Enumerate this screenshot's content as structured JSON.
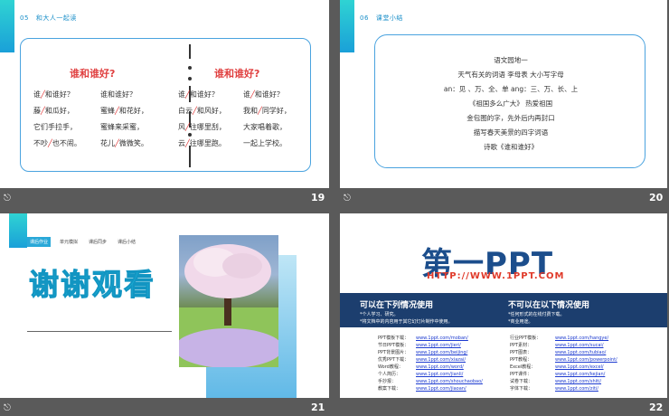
{
  "slides": [
    {
      "number": "19",
      "section_num": "05",
      "section_title": "和大人一起读",
      "footer_icon": "⎋",
      "left_poem": {
        "title": "谁和谁好?",
        "lines": [
          [
            "谁",
            "和谁好？",
            "谁和谁好？"
          ],
          [
            "藤",
            "和瓜好，",
            "蜜蜂",
            "和花好，"
          ],
          [
            "它们手拉手，",
            "蜜蜂来采蜜，"
          ],
          [
            "不吵",
            "也不闹。",
            "花儿",
            "微微笑。"
          ]
        ]
      },
      "left_col_a": [
        "谁╱和谁好？",
        "藤╱和瓜好，",
        "它们手拉手，",
        "不吵╱也不闹。"
      ],
      "left_col_b": [
        "谁和谁好？",
        "蜜蜂╱和花好，",
        "蜜蜂来采蜜，",
        "花儿╱微微笑。"
      ],
      "right_title": "谁和谁好?",
      "right_col_a": [
        "谁╱和谁好？",
        "白云╱和风好，",
        "风╱往哪里刮，",
        "云╱往哪里跑。"
      ],
      "right_col_b": [
        "谁╱和谁好？",
        "我和╱同学好，",
        "大家唱着歌，",
        "一起上学校。"
      ]
    },
    {
      "number": "20",
      "section_num": "06",
      "section_title": "课堂小结",
      "footer_icon": "⎋",
      "lines": [
        "语文园地一",
        "天气有关的词语    李母表  大小写字母",
        "an：见  、万、全、单  ang：三、万、长、上",
        "《祖国多么广大》  热爱祖国",
        "金包图的字，先外后内再封口",
        "描写春天美景的四字词语",
        "诗歌《谁和谁好》"
      ]
    },
    {
      "number": "21",
      "footer_icon": "⎋",
      "tabs": [
        "课后作业",
        "单元模拟",
        "课后同步",
        "课后小结"
      ],
      "thanks": "谢谢观看"
    },
    {
      "number": "22",
      "logo": "第一PPT",
      "url": "HTTP://WWW.1PPT.COM",
      "can_title": "可以在下列情况使用",
      "can_items": [
        "*个人学习、研究。",
        "*将文档中的内容用于其它幻灯片制作中使用。"
      ],
      "cannot_title": "不可以在以下情况使用",
      "cannot_items": [
        "*任何形式的在线付费下载。",
        "*商业用途。"
      ],
      "left_links": [
        [
          "PPT模板下载：",
          "www.1ppt.com/moban/"
        ],
        [
          "节日PPT模板：",
          "www.1ppt.com/jieri/"
        ],
        [
          "PPT背景图片：",
          "www.1ppt.com/beijing/"
        ],
        [
          "优秀PPT下载：",
          "www.1ppt.com/xiazai/"
        ],
        [
          "Word教程：",
          "www.1ppt.com/word/"
        ],
        [
          "个人简历：",
          "www.1ppt.com/jianli/"
        ],
        [
          "手抄报：",
          "www.1ppt.com/shouchaobao/"
        ],
        [
          "教案下载：",
          "www.1ppt.com/jiaoan/"
        ]
      ],
      "right_links": [
        [
          "行业PPT模板：",
          "www.1ppt.com/hangye/"
        ],
        [
          "PPT素材：",
          "www.1ppt.com/sucai/"
        ],
        [
          "PPT图表：",
          "www.1ppt.com/tubiao/"
        ],
        [
          "PPT教程：",
          "www.1ppt.com/powerpoint/"
        ],
        [
          "Excel教程：",
          "www.1ppt.com/excel/"
        ],
        [
          "PPT课件：",
          "www.1ppt.com/kejian/"
        ],
        [
          "试卷下载：",
          "www.1ppt.com/shiti/"
        ],
        [
          "字体下载：",
          "www.1ppt.com/ziti/"
        ]
      ]
    }
  ]
}
